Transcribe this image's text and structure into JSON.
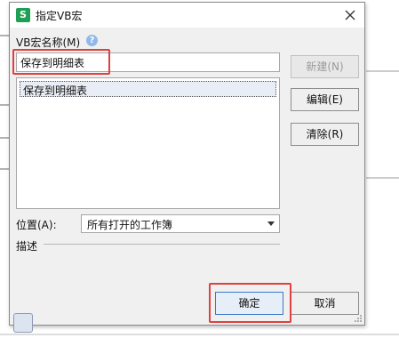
{
  "dialog": {
    "title": "指定VB宏",
    "app_icon_letter": "S"
  },
  "macro_name": {
    "label": "VB宏名称(M)",
    "value": "保存到明细表"
  },
  "macro_list": {
    "items": [
      "保存到明细表"
    ]
  },
  "buttons": {
    "new": "新建(N)",
    "edit": "编辑(E)",
    "clear": "清除(R)",
    "ok": "确定",
    "cancel": "取消"
  },
  "location": {
    "label": "位置(A):",
    "selected": "所有打开的工作簿"
  },
  "description": {
    "label": "描述"
  },
  "colors": {
    "highlight": "#e04040",
    "app_icon": "#1f9f55",
    "help_icon": "#90b8ea"
  }
}
